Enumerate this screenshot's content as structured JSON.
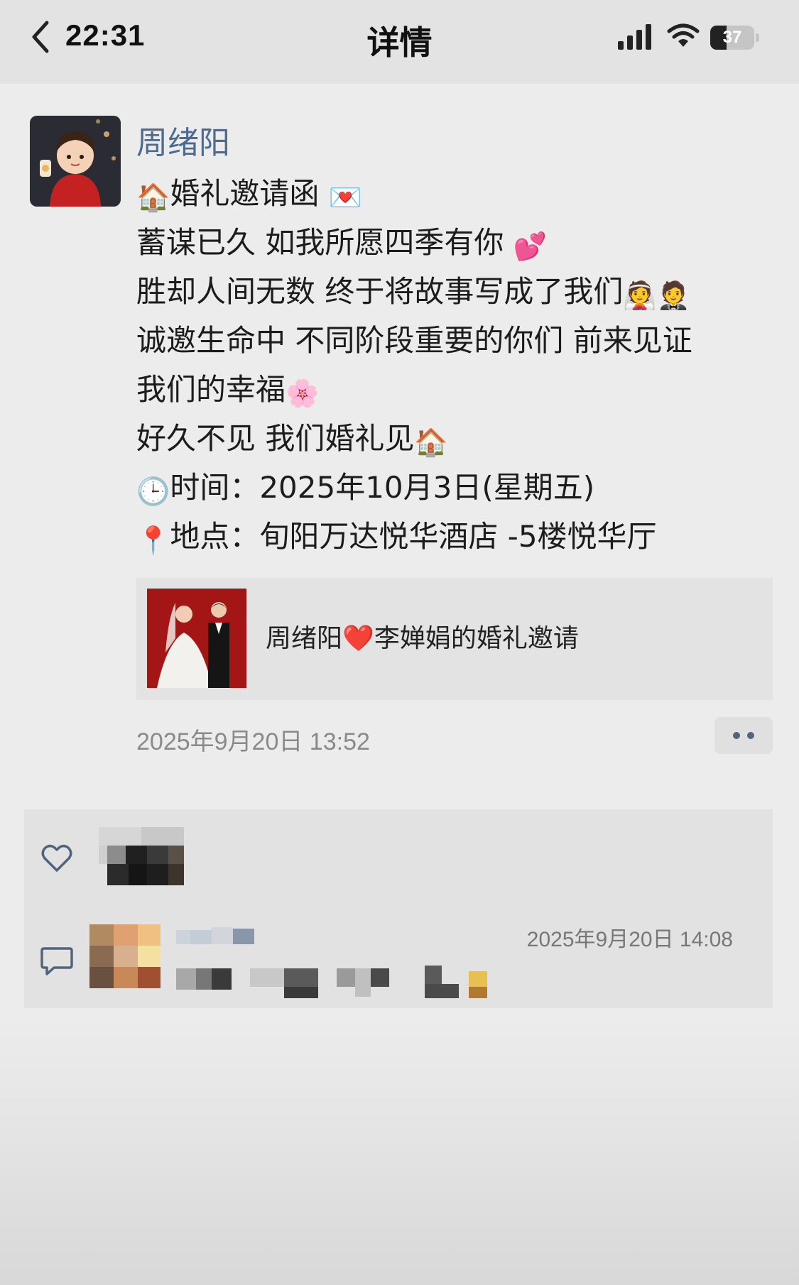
{
  "status_bar": {
    "time": "22:31",
    "title": "详情",
    "battery": "37",
    "battery_level": 0.37,
    "icons": [
      "back-chevron-icon",
      "cellular-signal-icon",
      "wifi-icon",
      "battery-icon"
    ]
  },
  "post": {
    "author": "周绪阳",
    "lines": [
      {
        "pre": "🏠",
        "text": "婚礼邀请函 ",
        "post": "💌"
      },
      {
        "pre": "",
        "text": "蓄谋已久 如我所愿四季有你 ",
        "post": "💕"
      },
      {
        "pre": "",
        "text": "胜却人间无数 终于将故事写成了我们",
        "post": "👰🤵"
      },
      {
        "pre": "",
        "text": "诚邀生命中 不同阶段重要的你们 前来见证",
        "post": ""
      },
      {
        "pre": "",
        "text": "我们的幸福",
        "post": "🌸"
      },
      {
        "pre": "",
        "text": "好久不见 我们婚礼见",
        "post": "🏠"
      },
      {
        "pre": "🕒",
        "text": "时间：2025年10月3日(星期五)",
        "post": ""
      },
      {
        "pre": "📍",
        "text": "地点：旬阳万达悦华酒店 -5楼悦华厅",
        "post": ""
      }
    ],
    "link_card": {
      "title_part1": "周绪阳",
      "heart": "❤️",
      "title_part2": "李婵娟的婚礼邀请"
    },
    "timestamp": "2025年9月20日 13:52",
    "more_icon": "more-dots-icon"
  },
  "interactions": {
    "like_icon": "heart-outline-icon",
    "comment_icon": "comment-bubble-icon",
    "comment_time": "2025年9月20日 14:08"
  },
  "colors": {
    "author_name": "#4d6a8f",
    "card_bg": "#e3e3e3",
    "page_bg": "#ececec"
  }
}
